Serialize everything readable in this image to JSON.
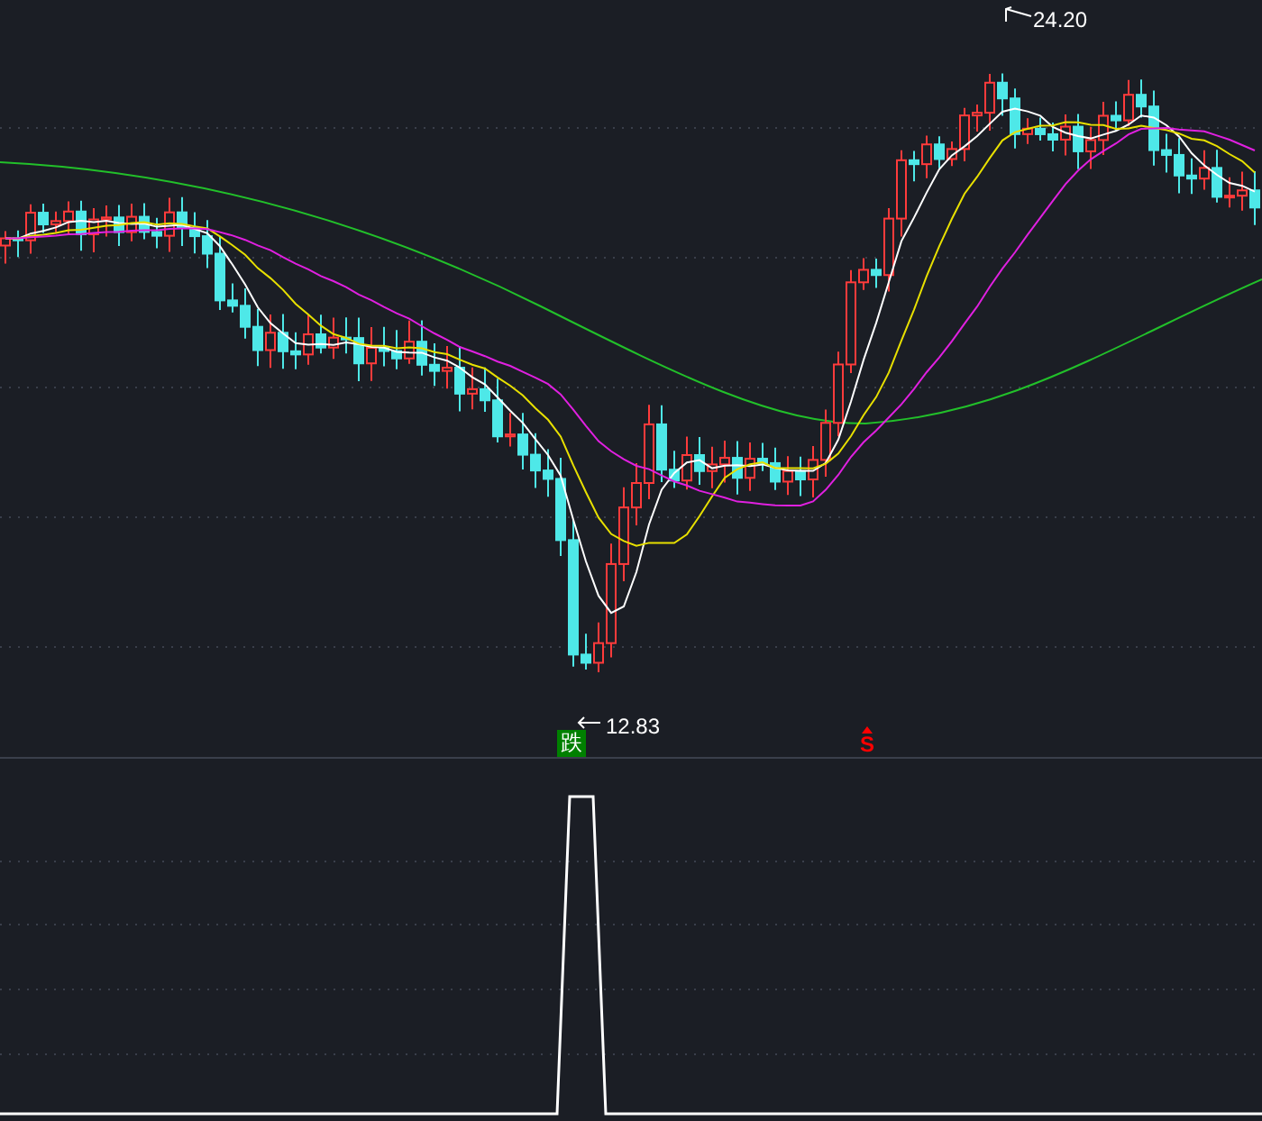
{
  "main_chart": {
    "high_label": "24.20",
    "low_label": "12.83",
    "signals": [
      {
        "kind": "badge",
        "text": "跌",
        "color": "#008000"
      },
      {
        "kind": "arrow",
        "text": "S",
        "color": "#ff0000"
      }
    ]
  }
}
